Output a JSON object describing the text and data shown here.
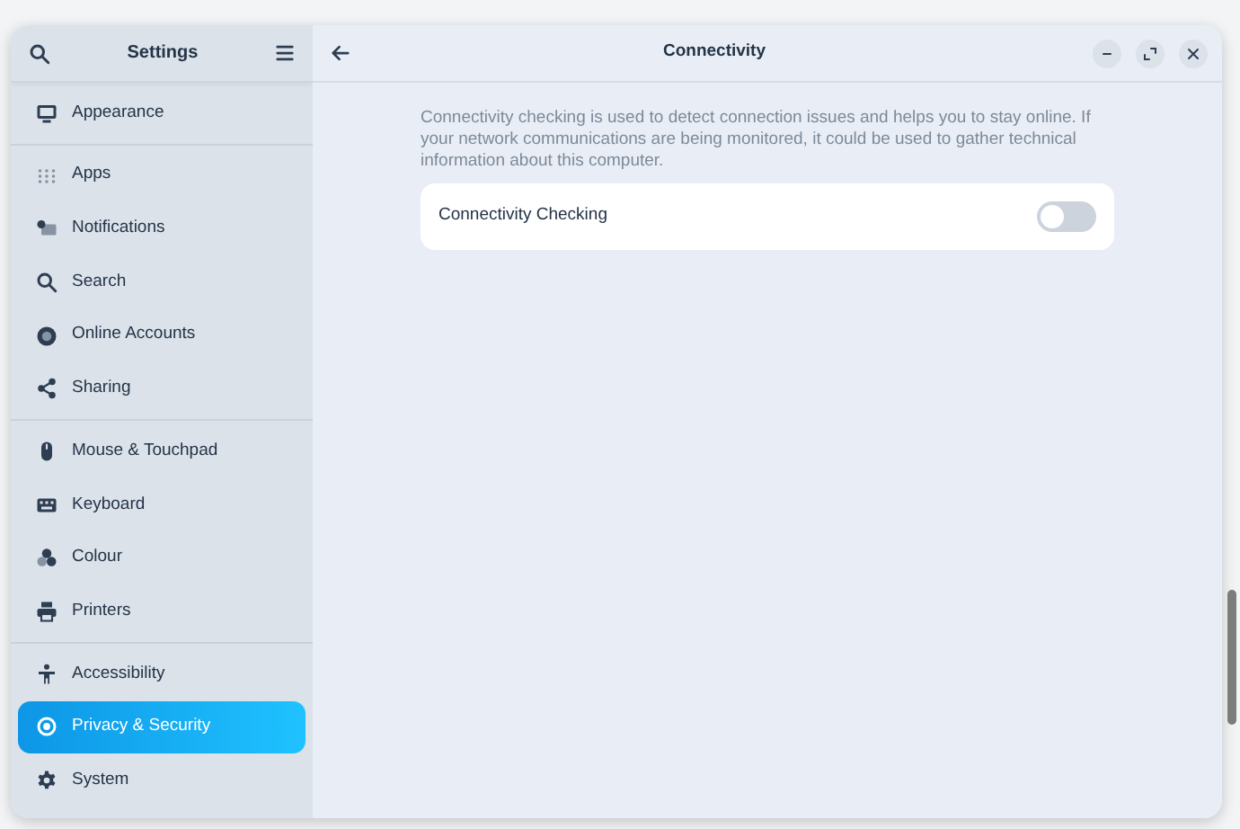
{
  "sidebar": {
    "title": "Settings",
    "groups": [
      [
        {
          "label": "Appearance",
          "selected": false
        }
      ],
      [
        {
          "label": "Apps",
          "selected": false
        },
        {
          "label": "Notifications",
          "selected": false
        },
        {
          "label": "Search",
          "selected": false
        },
        {
          "label": "Online Accounts",
          "selected": false
        },
        {
          "label": "Sharing",
          "selected": false
        }
      ],
      [
        {
          "label": "Mouse & Touchpad",
          "selected": false
        },
        {
          "label": "Keyboard",
          "selected": false
        },
        {
          "label": "Colour",
          "selected": false
        },
        {
          "label": "Printers",
          "selected": false
        }
      ],
      [
        {
          "label": "Accessibility",
          "selected": false
        },
        {
          "label": "Privacy & Security",
          "selected": true
        },
        {
          "label": "System",
          "selected": false
        }
      ]
    ]
  },
  "page": {
    "title": "Connectivity",
    "description": "Connectivity checking is used to detect connection issues and helps you to stay online. If your network communications are being monitored, it could be used to gather technical information about this computer.",
    "settings": [
      {
        "label": "Connectivity Checking",
        "on": false
      }
    ]
  }
}
